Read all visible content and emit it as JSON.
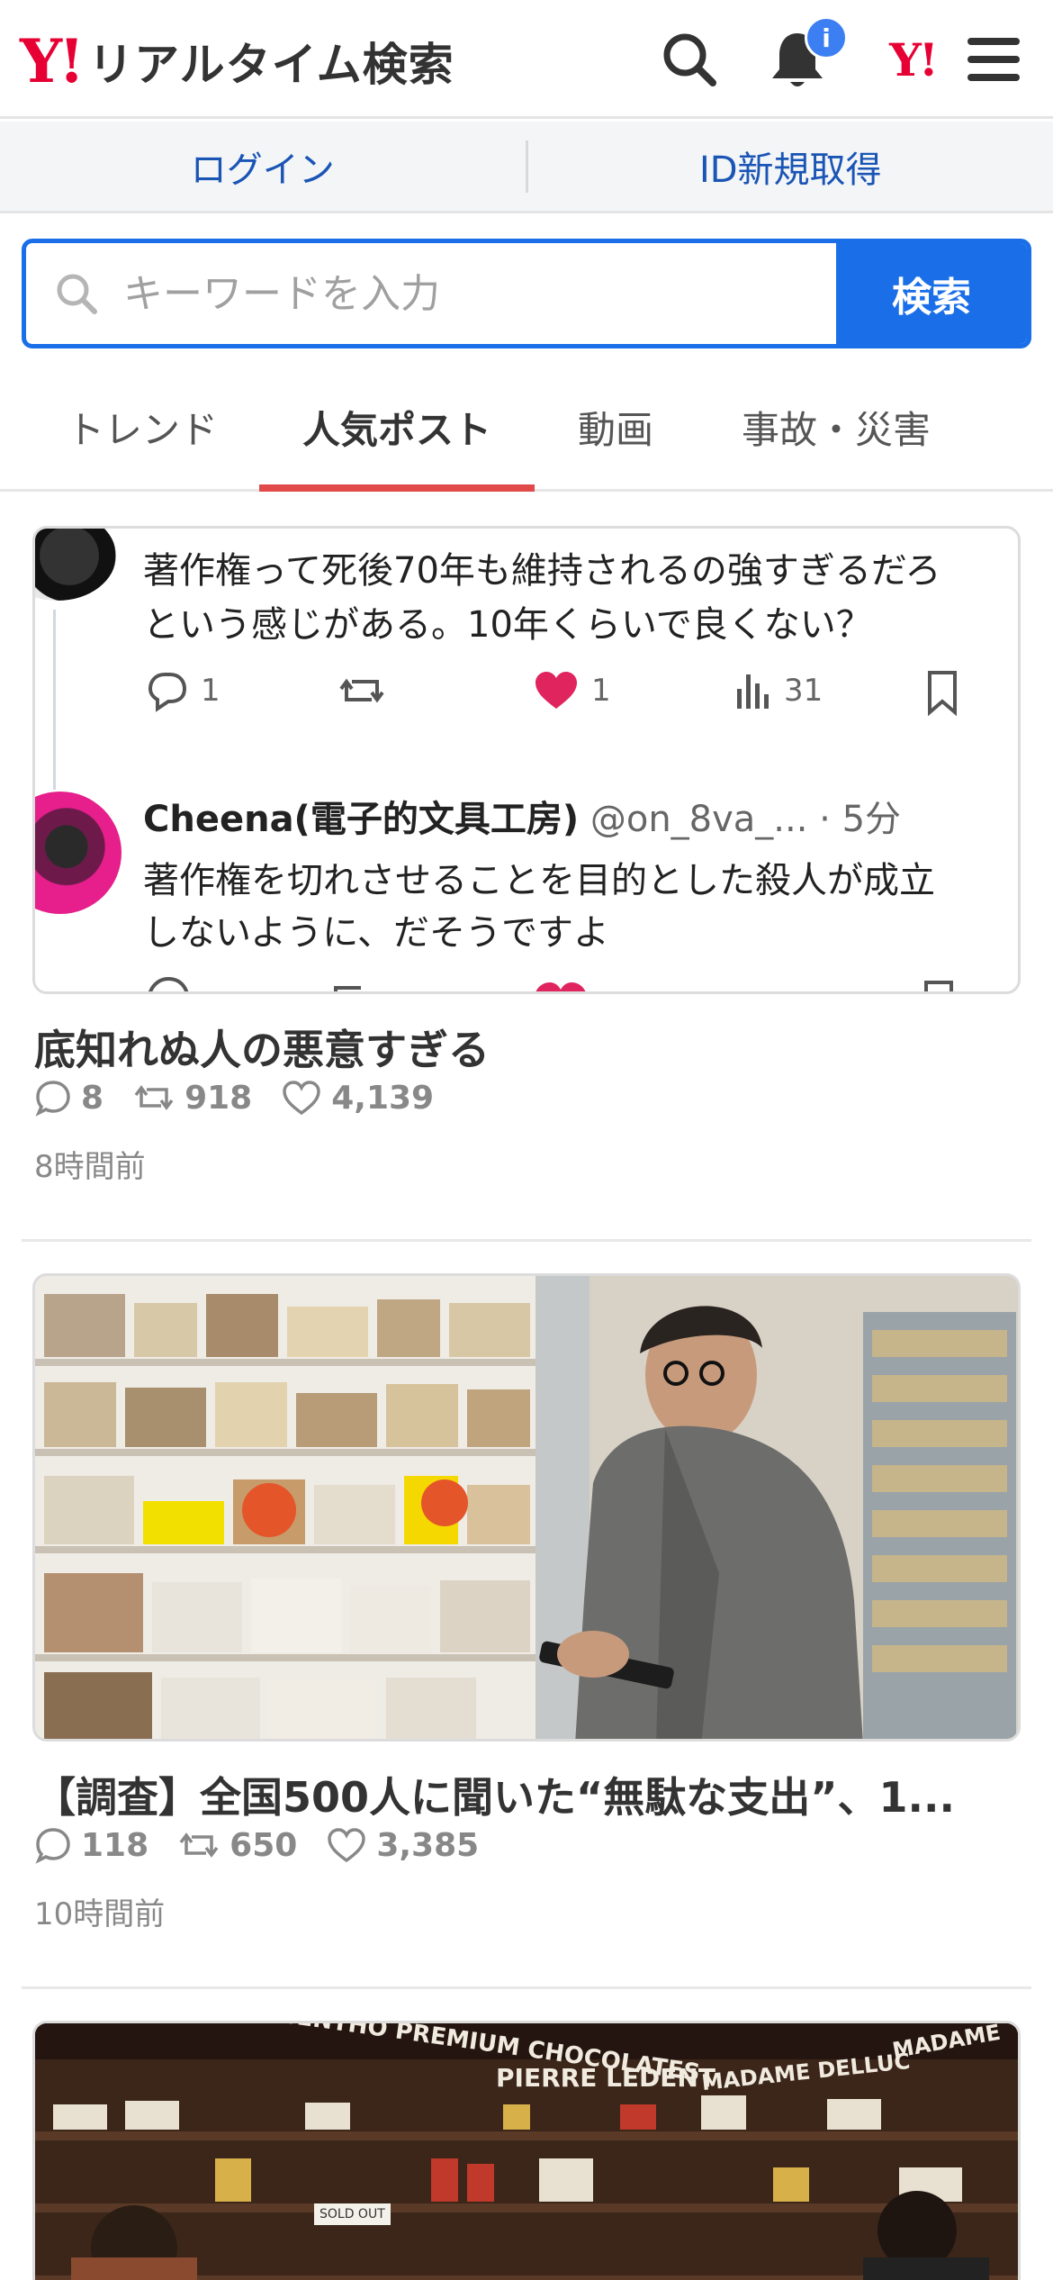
{
  "header": {
    "logo_mark": "Y!",
    "logo_text": "リアルタイム検索",
    "notification_badge": "i",
    "yahoo_mark": "Y!"
  },
  "login_bar": {
    "login_label": "ログイン",
    "register_label": "ID新規取得"
  },
  "search": {
    "placeholder": "キーワードを入力",
    "button_label": "検索"
  },
  "tabs": [
    {
      "label": "トレンド",
      "active": false
    },
    {
      "label": "人気ポスト",
      "active": true
    },
    {
      "label": "動画",
      "active": false
    },
    {
      "label": "事故・災害",
      "active": false
    }
  ],
  "posts": [
    {
      "embedded_tweet": {
        "line1": "著作権って死後70年も維持されるの強すぎるだろ",
        "line2": "という感じがある。10年くらいで良くない？",
        "replies": "1",
        "likes": "1",
        "views": "31",
        "reply_name": "Cheena(電子的文具工房)",
        "reply_handle": "@on_8va_...",
        "reply_time": "· 5分",
        "reply_line1": "著作権を切れさせることを目的とした殺人が成立",
        "reply_line2": "しないように、だそうですよ"
      },
      "title": "底知れぬ人の悪意すぎる",
      "comments": "8",
      "retweets": "918",
      "likes": "4,139",
      "time": "8時間前"
    },
    {
      "title": "【調査】全国500人に聞いた“無駄な支出”、1...",
      "comments": "118",
      "retweets": "650",
      "likes": "3,385",
      "time": "10時間前"
    },
    {
      "store_signs": [
        "CENTHO PREMIUM CHOCOLATES",
        "PIERRE LEDENT",
        "MADAME DELLUC",
        "MADAME",
        "SOLD OUT"
      ]
    }
  ],
  "colors": {
    "brand_red": "#e60033",
    "link_blue": "#1a55b5",
    "search_blue": "#1a6fe8",
    "tab_underline": "#e24a4a",
    "like_pink": "#e0245e"
  }
}
